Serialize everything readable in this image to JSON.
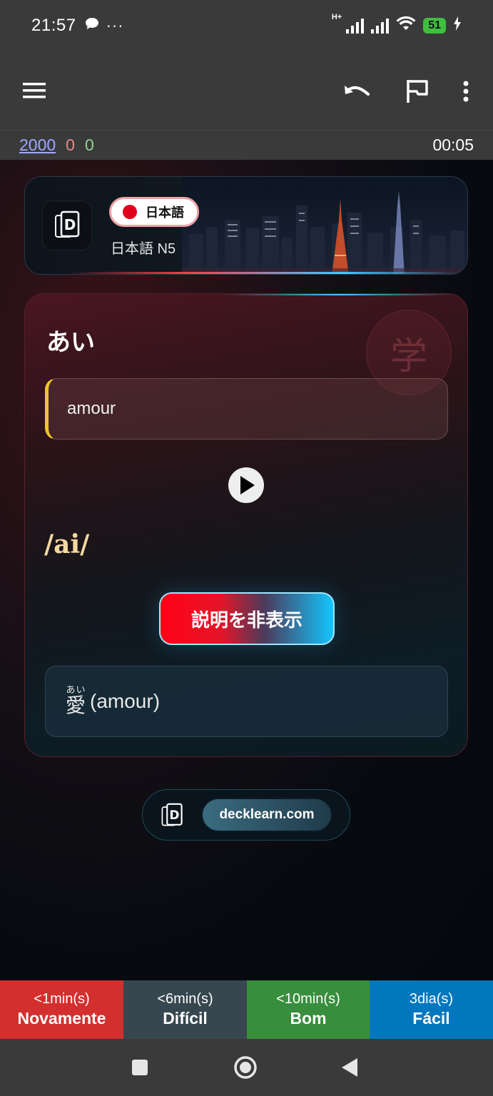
{
  "status_bar": {
    "time": "21:57",
    "overflow": "···",
    "network": "H+",
    "battery": "51"
  },
  "counters": {
    "new": "2000",
    "learning": "0",
    "review": "0",
    "timer": "00:05"
  },
  "header": {
    "language_badge": "日本語",
    "deck_name": "日本語 N5"
  },
  "card": {
    "watermark": "学",
    "word": "あい",
    "meaning": "amour",
    "reading": "/ai/",
    "toggle_button": "説明を非表示",
    "explanation": {
      "kanji": "愛",
      "furigana": "あい",
      "text": "(amour)"
    }
  },
  "footer": {
    "site": "decklearn.com"
  },
  "answers": [
    {
      "interval": "<1min(s)",
      "label": "Novamente",
      "color": "#d32f2f"
    },
    {
      "interval": "<6min(s)",
      "label": "Difícil",
      "color": "#37474f"
    },
    {
      "interval": "<10min(s)",
      "label": "Bom",
      "color": "#388e3c"
    },
    {
      "interval": "3dia(s)",
      "label": "Fácil",
      "color": "#0277bd"
    }
  ],
  "colors": {
    "accent_red": "#ff0016",
    "accent_cyan": "#12c6ff",
    "reading_gold": "#f3d8a0",
    "meaning_bar": "#f1c232"
  }
}
